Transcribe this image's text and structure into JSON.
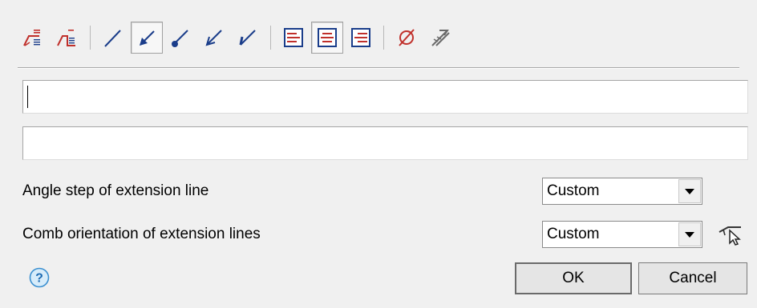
{
  "toolbar": {
    "groups": [
      [
        "extension-line-text-up-icon",
        "extension-line-text-down-icon"
      ],
      [
        "leader-none-icon",
        "leader-filled-arrow-icon",
        "leader-dot-icon",
        "leader-open-arrow-icon",
        "leader-tick-arrow-icon"
      ],
      [
        "align-left-icon",
        "align-center-icon",
        "align-right-icon"
      ],
      [
        "diameter-symbol-icon",
        "pointer-on-surface-icon"
      ]
    ],
    "pressed": [
      "leader-filled-arrow-icon",
      "align-center-icon"
    ],
    "colors": {
      "red": "#c0302b",
      "blue": "#1a3d8a",
      "gray": "#6a6a6a"
    }
  },
  "text_field_1": {
    "value": "",
    "placeholder": ""
  },
  "text_field_2": {
    "value": "",
    "placeholder": ""
  },
  "angle_step": {
    "label": "Angle step of extension line",
    "value": "Custom"
  },
  "comb_orientation": {
    "label": "Comb orientation of extension lines",
    "value": "Custom"
  },
  "buttons": {
    "ok": "OK",
    "cancel": "Cancel"
  },
  "icons": {
    "help": "help-icon",
    "pick": "pick-direction-icon"
  }
}
